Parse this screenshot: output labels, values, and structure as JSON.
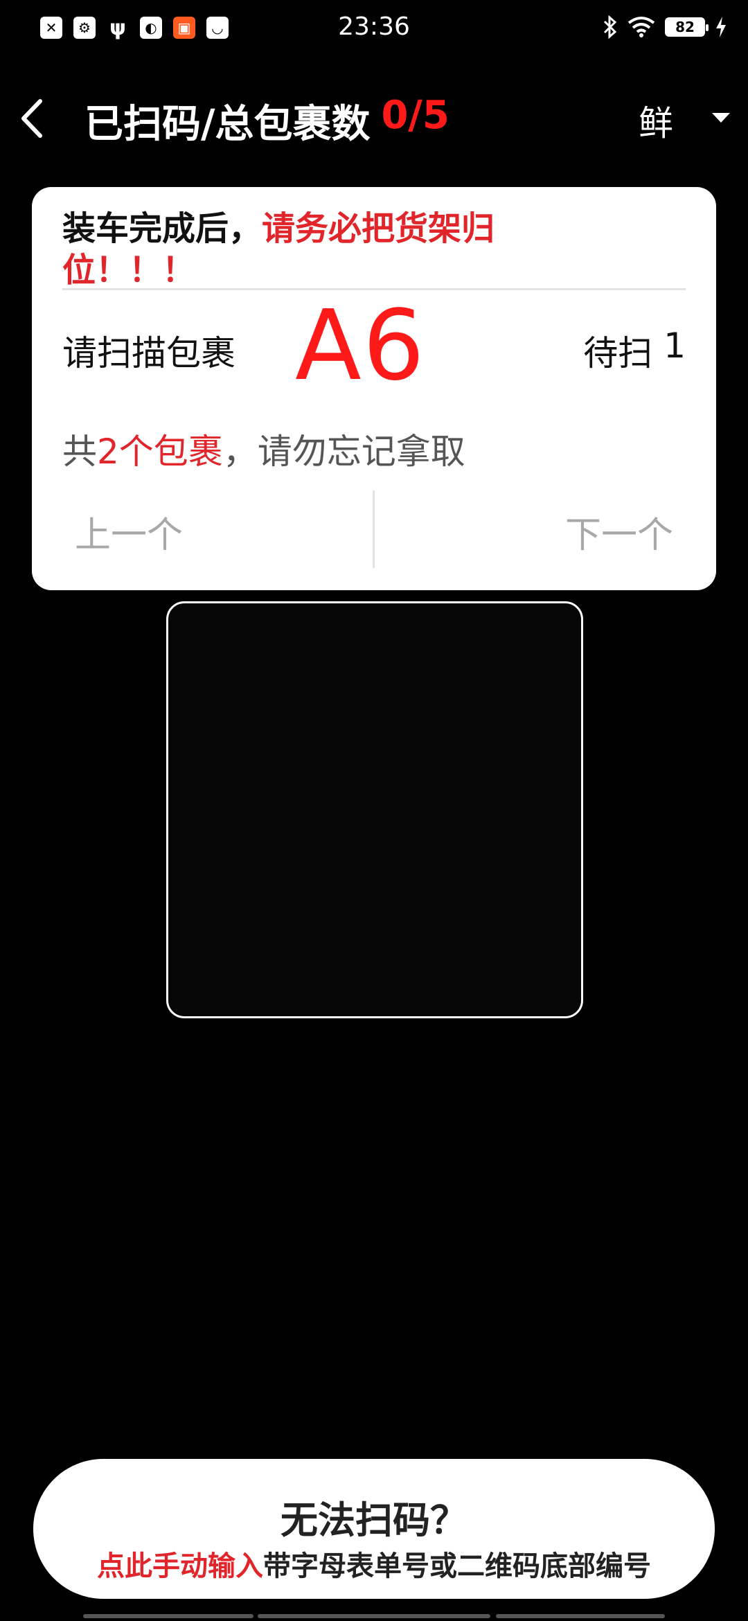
{
  "status_bar": {
    "time": "23:36",
    "battery": "82",
    "left_icons": [
      "sim-error-icon",
      "usb-debug-icon",
      "usb-icon",
      "app-icon",
      "orange-app-icon",
      "shopping-app-icon"
    ],
    "right_icons": [
      "bluetooth-icon",
      "wifi-icon",
      "battery-icon",
      "charging-icon"
    ]
  },
  "top_bar": {
    "title": "已扫码/总包裹数",
    "count": "0/5",
    "tag": "鲜"
  },
  "card": {
    "notice_prefix": "装车完成后，",
    "notice_red": "请务必把货架归位！！！",
    "scan_prompt": "请扫描包裹",
    "shelf_code": "A6",
    "pending_label": "待扫",
    "pending_count": "1",
    "reminder_prefix": "共",
    "reminder_red": "2个包裹",
    "reminder_suffix": "，请勿忘记拿取",
    "prev_label": "上一个",
    "next_label": "下一个"
  },
  "manual_input": {
    "title": "无法扫码？",
    "sub_red": "点此手动输入",
    "sub_rest": "带字母表单号或二维码底部编号"
  },
  "colors": {
    "accent_red": "#e0252b",
    "count_red": "#ff1a1a",
    "background": "#000000"
  }
}
